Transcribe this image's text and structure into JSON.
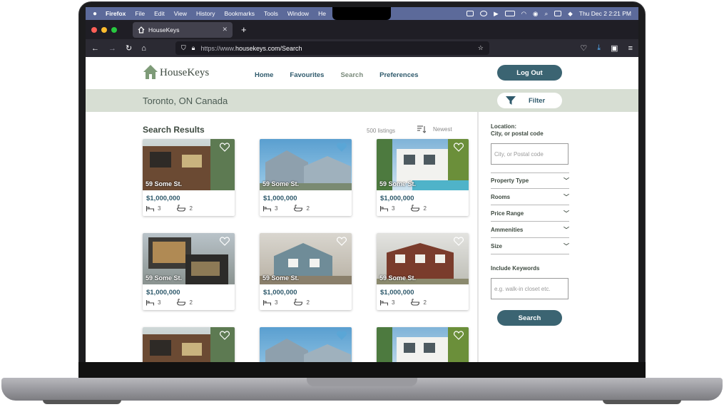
{
  "menubar": {
    "app": "Firefox",
    "items": [
      "File",
      "Edit",
      "View",
      "History",
      "Bookmarks",
      "Tools",
      "Window",
      "He"
    ],
    "clock": "Thu Dec 2  2:21 PM"
  },
  "browser": {
    "tab_title": "HouseKeys",
    "url_prefix": "https://www.",
    "url_host": "housekeys.com/Search"
  },
  "site": {
    "logo_text": "HouseKeys",
    "nav": [
      "Home",
      "Favourites",
      "Search",
      "Preferences"
    ],
    "active_nav": "Search",
    "logout_label": "Log Out"
  },
  "location_bar": {
    "title": "Toronto, ON Canada",
    "filter_label": "Filter"
  },
  "results": {
    "title": "Search Results",
    "count": "500 listings",
    "sort_label": "Newest",
    "listings": [
      {
        "address": "59 Some St.",
        "price": "$1,000,000",
        "beds": "3",
        "baths": "2",
        "favourite": false,
        "style": "modern-wood"
      },
      {
        "address": "59 Some St.",
        "price": "$1,000,000",
        "beds": "3",
        "baths": "2",
        "favourite": true,
        "style": "blue-townhouse"
      },
      {
        "address": "59 Some St.",
        "price": "$1,000,000",
        "beds": "3",
        "baths": "2",
        "favourite": false,
        "style": "white-villa"
      },
      {
        "address": "59 Some St.",
        "price": "$1,000,000",
        "beds": "3",
        "baths": "2",
        "favourite": false,
        "style": "modern-box"
      },
      {
        "address": "59 Some St.",
        "price": "$1,000,000",
        "beds": "3",
        "baths": "2",
        "favourite": false,
        "style": "suburban-house"
      },
      {
        "address": "59 Some St.",
        "price": "$1,000,000",
        "beds": "3",
        "baths": "2",
        "favourite": false,
        "style": "brick-house"
      },
      {
        "address": "",
        "price": "",
        "beds": "",
        "baths": "",
        "favourite": false,
        "style": "modern-wood"
      },
      {
        "address": "",
        "price": "",
        "beds": "",
        "baths": "",
        "favourite": true,
        "style": "blue-townhouse"
      },
      {
        "address": "",
        "price": "",
        "beds": "",
        "baths": "",
        "favourite": false,
        "style": "white-villa"
      }
    ]
  },
  "sidebar": {
    "location_label_1": "Location:",
    "location_label_2": "City, or postal code",
    "location_placeholder": "City, or Postal code",
    "filters": [
      "Property Type",
      "Rooms",
      "Price Range",
      "Ammenities",
      "Size"
    ],
    "keywords_label": "Include Keywords",
    "keywords_placeholder": "e.g. walk-in closet etc.",
    "search_label": "Search"
  },
  "colors": {
    "primary": "#3b6472",
    "accent_band": "#d7ded3",
    "heart_fav": "#5aa6d6",
    "menubar": "#5c6a9a"
  }
}
